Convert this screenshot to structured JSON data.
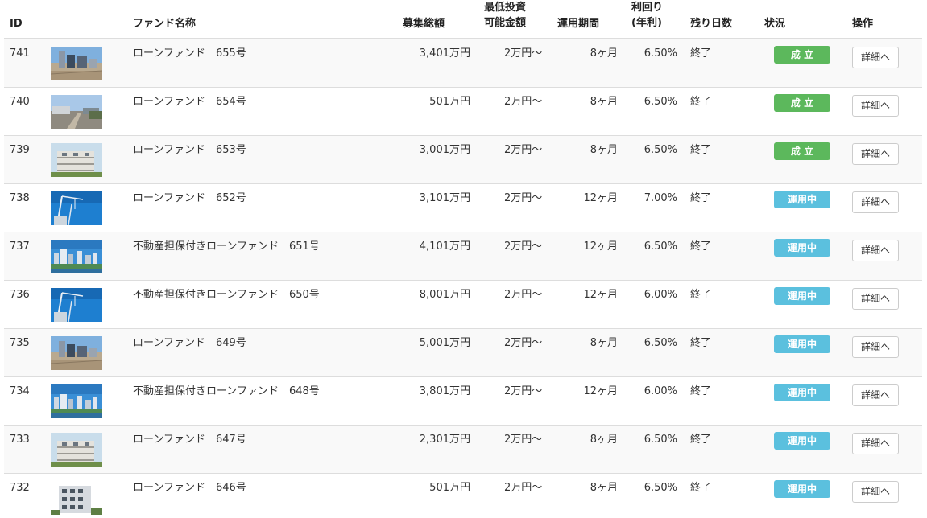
{
  "headers": {
    "id": "ID",
    "name": "ファンド名称",
    "total": "募集総額",
    "min_invest": "最低投資\n可能金額",
    "period": "運用期間",
    "yield": "利回り\n(年利)",
    "days_left": "残り日数",
    "status": "状況",
    "action": "操作"
  },
  "colors": {
    "status_success": "#5cb85c",
    "status_active": "#5bc0de",
    "row_stripe": "#f9f9f9",
    "border": "#dddddd"
  },
  "rows": [
    {
      "id": "741",
      "thumb_icon": "highrise-construction-photo",
      "name": "ローンファンド　655号",
      "total": "3,401万円",
      "min": "2万円～",
      "period": "8ヶ月",
      "yield": "6.50%",
      "days": "終了",
      "status": "成 立",
      "status_type": "success",
      "action": "詳細へ"
    },
    {
      "id": "740",
      "thumb_icon": "vacant-lot-photo",
      "name": "ローンファンド　654号",
      "total": "501万円",
      "min": "2万円～",
      "period": "8ヶ月",
      "yield": "6.50%",
      "days": "終了",
      "status": "成 立",
      "status_type": "success",
      "action": "詳細へ"
    },
    {
      "id": "739",
      "thumb_icon": "apartment-building-photo",
      "name": "ローンファンド　653号",
      "total": "3,001万円",
      "min": "2万円～",
      "period": "8ヶ月",
      "yield": "6.50%",
      "days": "終了",
      "status": "成 立",
      "status_type": "success",
      "action": "詳細へ"
    },
    {
      "id": "738",
      "thumb_icon": "crane-sky-photo",
      "name": "ローンファンド　652号",
      "total": "3,101万円",
      "min": "2万円～",
      "period": "12ヶ月",
      "yield": "7.00%",
      "days": "終了",
      "status": "運用中",
      "status_type": "active",
      "action": "詳細へ"
    },
    {
      "id": "737",
      "thumb_icon": "city-skyline-photo",
      "name": "不動産担保付きローンファンド　651号",
      "total": "4,101万円",
      "min": "2万円～",
      "period": "12ヶ月",
      "yield": "6.50%",
      "days": "終了",
      "status": "運用中",
      "status_type": "active",
      "action": "詳細へ"
    },
    {
      "id": "736",
      "thumb_icon": "crane-sky-photo",
      "name": "不動産担保付きローンファンド　650号",
      "total": "8,001万円",
      "min": "2万円～",
      "period": "12ヶ月",
      "yield": "6.00%",
      "days": "終了",
      "status": "運用中",
      "status_type": "active",
      "action": "詳細へ"
    },
    {
      "id": "735",
      "thumb_icon": "highrise-construction-photo",
      "name": "ローンファンド　649号",
      "total": "5,001万円",
      "min": "2万円～",
      "period": "8ヶ月",
      "yield": "6.50%",
      "days": "終了",
      "status": "運用中",
      "status_type": "active",
      "action": "詳細へ"
    },
    {
      "id": "734",
      "thumb_icon": "city-skyline-photo",
      "name": "不動産担保付きローンファンド　648号",
      "total": "3,801万円",
      "min": "2万円～",
      "period": "12ヶ月",
      "yield": "6.00%",
      "days": "終了",
      "status": "運用中",
      "status_type": "active",
      "action": "詳細へ"
    },
    {
      "id": "733",
      "thumb_icon": "apartment-building-photo",
      "name": "ローンファンド　647号",
      "total": "2,301万円",
      "min": "2万円～",
      "period": "8ヶ月",
      "yield": "6.50%",
      "days": "終了",
      "status": "運用中",
      "status_type": "active",
      "action": "詳細へ"
    },
    {
      "id": "732",
      "thumb_icon": "condo-building-photo",
      "name": "ローンファンド　646号",
      "total": "501万円",
      "min": "2万円～",
      "period": "8ヶ月",
      "yield": "6.50%",
      "days": "終了",
      "status": "運用中",
      "status_type": "active",
      "action": "詳細へ"
    }
  ]
}
